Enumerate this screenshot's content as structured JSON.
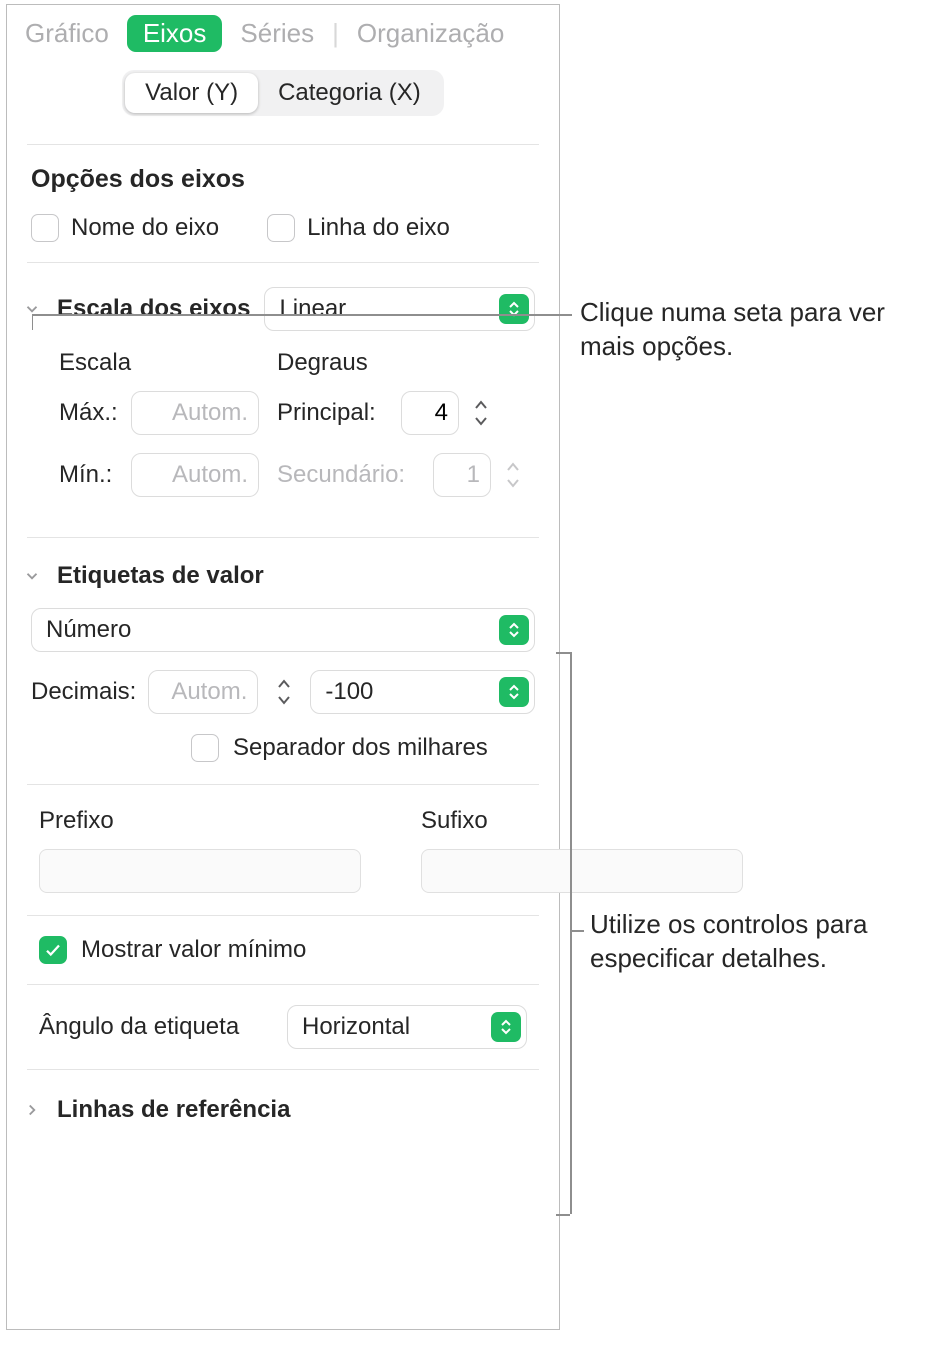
{
  "tabs": {
    "grafico": "Gráfico",
    "eixos": "Eixos",
    "series": "Séries",
    "organizacao": "Organização"
  },
  "segmented": {
    "valor_y": "Valor (Y)",
    "categoria_x": "Categoria (X)"
  },
  "axis_options": {
    "title": "Opções dos eixos",
    "nome_eixo": "Nome do eixo",
    "linha_eixo": "Linha do eixo"
  },
  "axis_scale": {
    "label": "Escala dos eixos",
    "type": "Linear",
    "escala": "Escala",
    "degraus": "Degraus",
    "max_label": "Máx.:",
    "min_label": "Mín.:",
    "placeholder": "Autom.",
    "principal_label": "Principal:",
    "principal_value": "4",
    "secundario_label": "Secundário:",
    "secundario_value": "1"
  },
  "value_labels": {
    "title": "Etiquetas de valor",
    "format": "Número",
    "decimals_label": "Decimais:",
    "decimals_placeholder": "Autom.",
    "negative_format": "-100",
    "thousands_sep": "Separador dos milhares",
    "prefixo": "Prefixo",
    "sufixo": "Sufixo",
    "show_min": "Mostrar valor mínimo",
    "angle_label": "Ângulo da etiqueta",
    "angle_value": "Horizontal"
  },
  "reference_lines": {
    "label": "Linhas de referência"
  },
  "callouts": {
    "top": "Clique numa seta para ver mais opções.",
    "bottom": "Utilize os controlos para especificar detalhes."
  }
}
